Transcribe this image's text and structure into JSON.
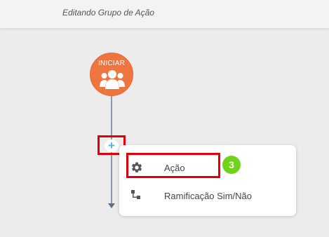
{
  "header": {
    "title": "Editando Grupo de Ação"
  },
  "flow": {
    "start_node": {
      "label": "INICIAR",
      "icon": "users-icon",
      "color": "#ee7440"
    },
    "add_button": {
      "icon": "plus-icon",
      "symbol": "+"
    }
  },
  "menu": {
    "items": [
      {
        "label": "Ação",
        "icon": "gear-icon"
      },
      {
        "label": "Ramificação Sim/Não",
        "icon": "branch-icon"
      }
    ]
  },
  "annotation": {
    "step_number": "3",
    "badge_color": "#6fd319",
    "highlight_color": "#e0000b"
  }
}
